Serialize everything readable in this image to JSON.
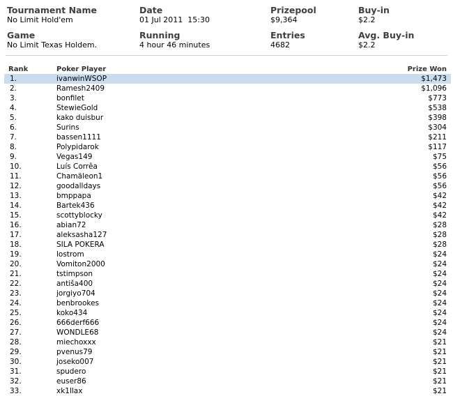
{
  "info": {
    "tournament_name_label": "Tournament Name",
    "tournament_name": "No Limit Hold'em",
    "date_label": "Date",
    "date": "01 Jul 2011  15:30",
    "prizepool_label": "Prizepool",
    "prizepool": "$9,364",
    "buyin_label": "Buy-in",
    "buyin": "$2.2",
    "game_label": "Game",
    "game": "No Limit Texas Holdem.",
    "running_label": "Running",
    "running": "4 hour 46 minutes",
    "entries_label": "Entries",
    "entries": "4682",
    "avg_buyin_label": "Avg. Buy-in",
    "avg_buyin": "$2.2"
  },
  "table": {
    "headers": {
      "rank": "Rank",
      "player": "Poker Player",
      "prize": "Prize Won"
    },
    "selected_row": 0,
    "rows": [
      {
        "rank": "1.",
        "player": "ivanwinWSOP",
        "prize": "$1,473"
      },
      {
        "rank": "2.",
        "player": "Ramesh2409",
        "prize": "$1,096"
      },
      {
        "rank": "3.",
        "player": "bonfilet",
        "prize": "$773"
      },
      {
        "rank": "4.",
        "player": "StewieGold",
        "prize": "$538"
      },
      {
        "rank": "5.",
        "player": "kako duisbur",
        "prize": "$398"
      },
      {
        "rank": "6.",
        "player": "Surins",
        "prize": "$304"
      },
      {
        "rank": "7.",
        "player": "bassen1111",
        "prize": "$211"
      },
      {
        "rank": "8.",
        "player": "Polypidarok",
        "prize": "$117"
      },
      {
        "rank": "9.",
        "player": "Vegas149",
        "prize": "$75"
      },
      {
        "rank": "10.",
        "player": "Luís Corrêa",
        "prize": "$56"
      },
      {
        "rank": "11.",
        "player": "Chamäleon1",
        "prize": "$56"
      },
      {
        "rank": "12.",
        "player": "goodalldays",
        "prize": "$56"
      },
      {
        "rank": "13.",
        "player": "bmppapa",
        "prize": "$42"
      },
      {
        "rank": "14.",
        "player": "Bartek436",
        "prize": "$42"
      },
      {
        "rank": "15.",
        "player": "scottyblocky",
        "prize": "$42"
      },
      {
        "rank": "16.",
        "player": "abian72",
        "prize": "$28"
      },
      {
        "rank": "17.",
        "player": "aleksasha127",
        "prize": "$28"
      },
      {
        "rank": "18.",
        "player": "SILA POKERA",
        "prize": "$28"
      },
      {
        "rank": "19.",
        "player": "lostrom",
        "prize": "$24"
      },
      {
        "rank": "20.",
        "player": "Vomiton2000",
        "prize": "$24"
      },
      {
        "rank": "21.",
        "player": "tstimpson",
        "prize": "$24"
      },
      {
        "rank": "22.",
        "player": "antiša400",
        "prize": "$24"
      },
      {
        "rank": "23.",
        "player": "jorgiyo704",
        "prize": "$24"
      },
      {
        "rank": "24.",
        "player": "benbrookes",
        "prize": "$24"
      },
      {
        "rank": "25.",
        "player": "koko434",
        "prize": "$24"
      },
      {
        "rank": "26.",
        "player": "666derf666",
        "prize": "$24"
      },
      {
        "rank": "27.",
        "player": "WONDLE68",
        "prize": "$24"
      },
      {
        "rank": "28.",
        "player": "miechoxxx",
        "prize": "$21"
      },
      {
        "rank": "29.",
        "player": "pvenus79",
        "prize": "$21"
      },
      {
        "rank": "30.",
        "player": "joseko007",
        "prize": "$21"
      },
      {
        "rank": "31.",
        "player": "spudero",
        "prize": "$21"
      },
      {
        "rank": "32.",
        "player": "euser86",
        "prize": "$21"
      },
      {
        "rank": "33.",
        "player": "xk1llax",
        "prize": "$21"
      }
    ]
  }
}
